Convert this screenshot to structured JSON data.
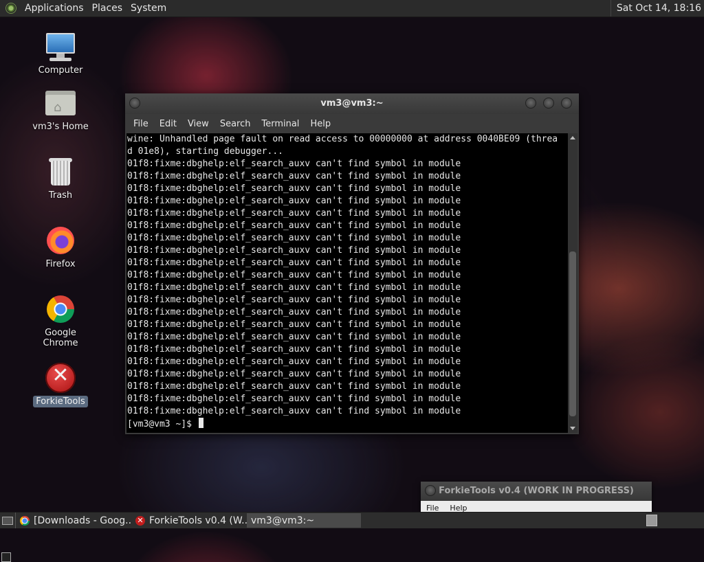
{
  "top_panel": {
    "menus": [
      "Applications",
      "Places",
      "System"
    ],
    "clock": "Sat Oct 14, 18:16"
  },
  "desktop_icons": [
    {
      "label": "Computer",
      "icon": "computer-icon"
    },
    {
      "label": "vm3's Home",
      "icon": "home-folder-icon"
    },
    {
      "label": "Trash",
      "icon": "trash-icon"
    },
    {
      "label": "Firefox",
      "icon": "firefox-icon"
    },
    {
      "label": "Google Chrome",
      "icon": "chrome-icon"
    },
    {
      "label": "ForkieTools",
      "icon": "forkietools-icon",
      "selected": true
    }
  ],
  "terminal": {
    "title": "vm3@vm3:~",
    "menus": [
      "File",
      "Edit",
      "View",
      "Search",
      "Terminal",
      "Help"
    ],
    "lines": [
      "wine: Unhandled page fault on read access to 00000000 at address 0040BE09 (threa",
      "d 01e8), starting debugger...",
      "01f8:fixme:dbghelp:elf_search_auxv can't find symbol in module",
      "01f8:fixme:dbghelp:elf_search_auxv can't find symbol in module",
      "01f8:fixme:dbghelp:elf_search_auxv can't find symbol in module",
      "01f8:fixme:dbghelp:elf_search_auxv can't find symbol in module",
      "01f8:fixme:dbghelp:elf_search_auxv can't find symbol in module",
      "01f8:fixme:dbghelp:elf_search_auxv can't find symbol in module",
      "01f8:fixme:dbghelp:elf_search_auxv can't find symbol in module",
      "01f8:fixme:dbghelp:elf_search_auxv can't find symbol in module",
      "01f8:fixme:dbghelp:elf_search_auxv can't find symbol in module",
      "01f8:fixme:dbghelp:elf_search_auxv can't find symbol in module",
      "01f8:fixme:dbghelp:elf_search_auxv can't find symbol in module",
      "01f8:fixme:dbghelp:elf_search_auxv can't find symbol in module",
      "01f8:fixme:dbghelp:elf_search_auxv can't find symbol in module",
      "01f8:fixme:dbghelp:elf_search_auxv can't find symbol in module",
      "01f8:fixme:dbghelp:elf_search_auxv can't find symbol in module",
      "01f8:fixme:dbghelp:elf_search_auxv can't find symbol in module",
      "01f8:fixme:dbghelp:elf_search_auxv can't find symbol in module",
      "01f8:fixme:dbghelp:elf_search_auxv can't find symbol in module",
      "01f8:fixme:dbghelp:elf_search_auxv can't find symbol in module",
      "01f8:fixme:dbghelp:elf_search_auxv can't find symbol in module",
      "01f8:fixme:dbghelp:elf_search_auxv can't find symbol in module"
    ],
    "prompt": "[vm3@vm3 ~]$ "
  },
  "background_window": {
    "title": "ForkieTools v0.4 (WORK IN PROGRESS)",
    "menus": [
      "File",
      "Help"
    ]
  },
  "taskbar": {
    "tasks": [
      {
        "label": "[Downloads - Goog...",
        "icon": "chrome-icon",
        "active": false
      },
      {
        "label": "ForkieTools v0.4 (W...",
        "icon": "forkietools-icon",
        "active": false
      },
      {
        "label": "vm3@vm3:~",
        "icon": "terminal-icon",
        "active": true
      }
    ]
  }
}
